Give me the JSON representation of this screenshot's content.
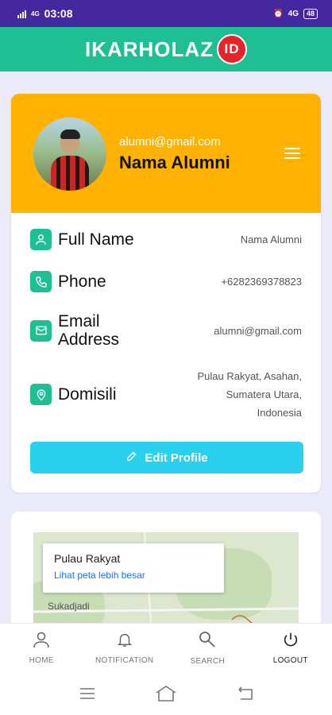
{
  "status_bar": {
    "network": "4G",
    "time": "03:08",
    "right_network": "4G",
    "battery": "48"
  },
  "app": {
    "brand_text": "IKARHOLAZ",
    "brand_badge": "ID",
    "colors": {
      "primary": "#1fbf94",
      "status_bar": "#4527a0",
      "profile_header": "#ffb300",
      "button": "#29d1ef",
      "badge": "#e8232a"
    }
  },
  "profile": {
    "email": "alumni@gmail.com",
    "name": "Nama Alumni",
    "menu_icon": "hamburger-menu-icon",
    "rows": [
      {
        "icon": "person-icon",
        "label": "Full Name",
        "value": "Nama Alumni"
      },
      {
        "icon": "phone-icon",
        "label": "Phone",
        "value": "+6282369378823"
      },
      {
        "icon": "email-icon",
        "label": "Email Address",
        "label_line1": "Email",
        "label_line2": "Address",
        "value": "alumni@gmail.com"
      },
      {
        "icon": "location-pin-icon",
        "label": "Domisili",
        "value_line1": "Pulau Rakyat, Asahan,",
        "value_line2": "Sumatera Utara,",
        "value_line3": "Indonesia"
      }
    ],
    "edit_button": "Edit Profile"
  },
  "map": {
    "title": "Pulau Rakyat",
    "link": "Lihat peta lebih besar",
    "place": "Sukadjadi"
  },
  "bottom_nav": [
    {
      "label": "HOME",
      "icon": "home-person-icon"
    },
    {
      "label": "NOTIFICATION",
      "icon": "bell-icon"
    },
    {
      "label": "SEARCH",
      "icon": "search-icon"
    },
    {
      "label": "LOGOUT",
      "icon": "power-icon"
    }
  ]
}
